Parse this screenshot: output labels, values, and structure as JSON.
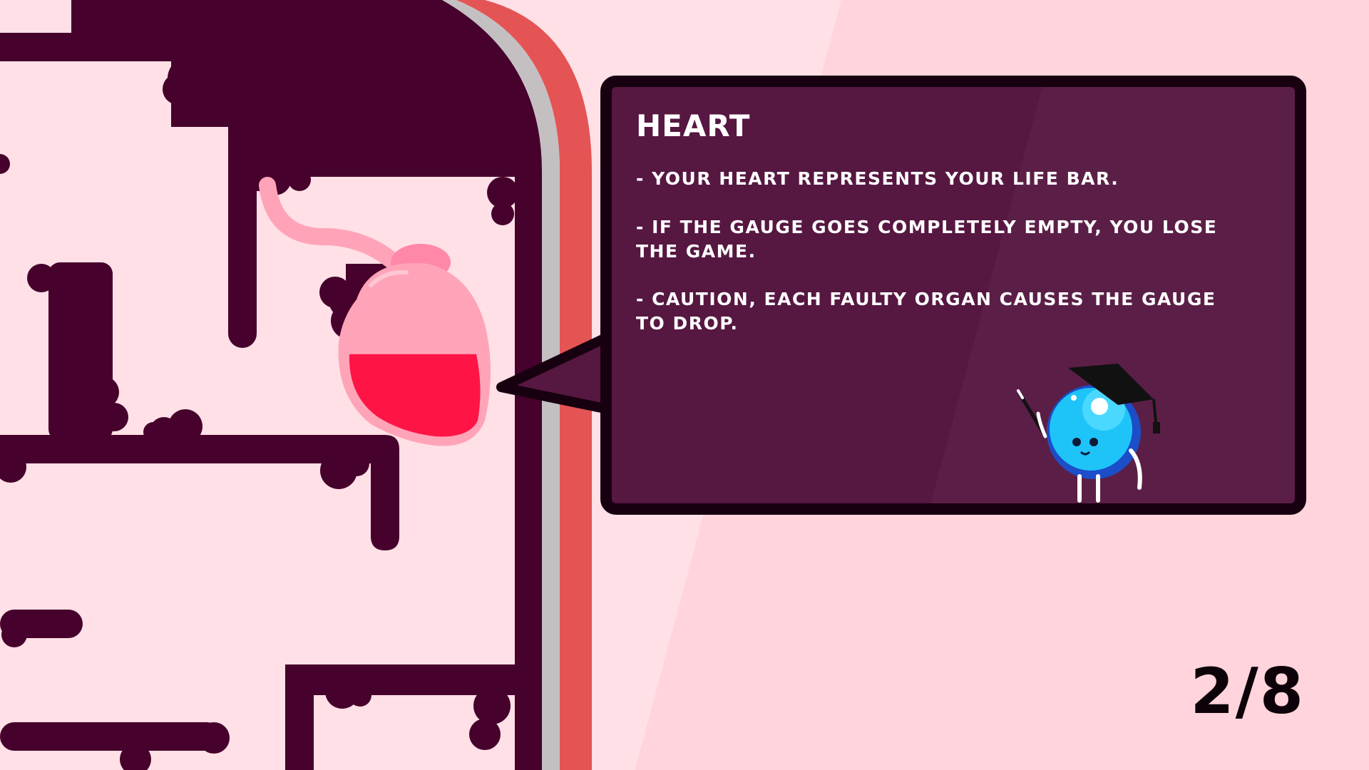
{
  "tutorial": {
    "title": "HEART",
    "rules": [
      "- YOUR HEART REPRESENTS YOUR LIFE BAR.",
      "- IF THE GAUGE GOES COMPLETELY EMPTY, YOU LOSE THE GAME.",
      "- CAUTION, EACH FAULTY ORGAN CAUSES THE GAUGE TO DROP."
    ]
  },
  "heart": {
    "gauge_level": 0.55
  },
  "pagination": {
    "current": "2",
    "separator": "/",
    "total": "8",
    "text": "2/8"
  },
  "icons": {
    "organ": "heart-icon",
    "mascot": "graduate-blob-icon",
    "pointer": "pointer-stick-icon"
  },
  "colors": {
    "background": "#ffe0e6",
    "maze_wall": "#46012c",
    "panel": "#561741",
    "panel_border": "#17000f",
    "heart_fill": "#ff1446",
    "heart_body": "#ffa4b8",
    "rim_gray": "#c4c0c2",
    "rim_red": "#e45454",
    "mascot_blue": "#1ec4f8"
  }
}
